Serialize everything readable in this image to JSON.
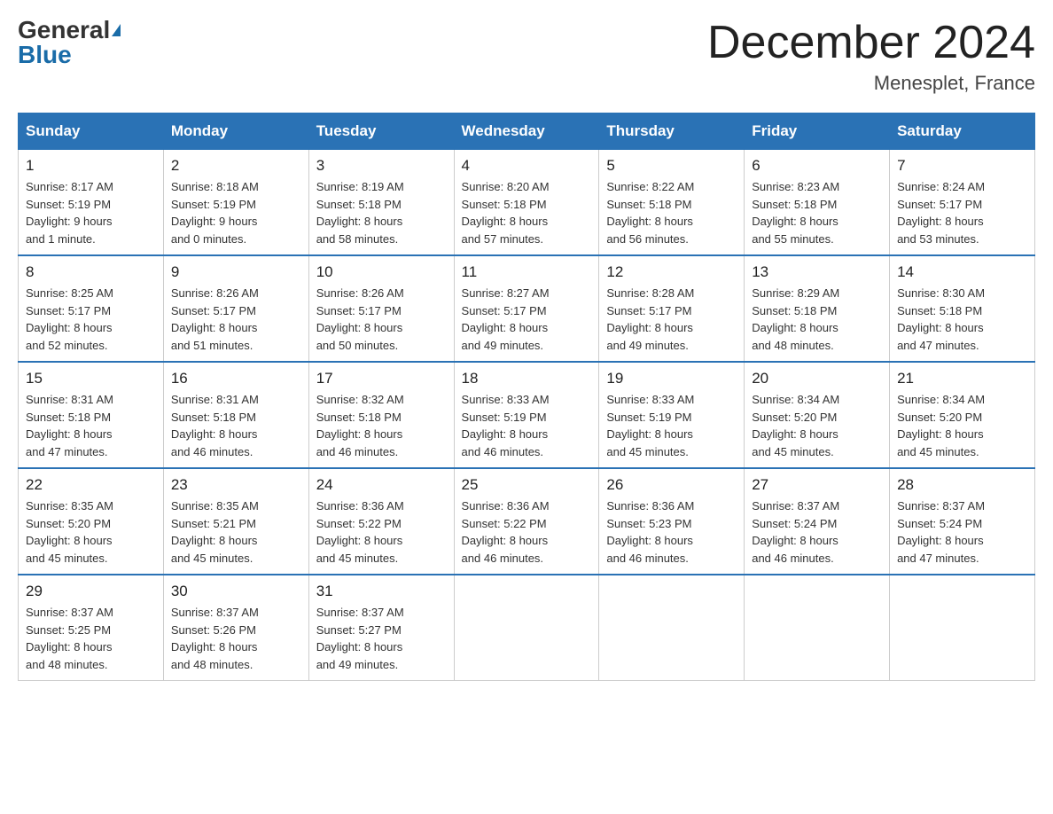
{
  "header": {
    "logo_general": "General",
    "logo_blue": "Blue",
    "month_title": "December 2024",
    "location": "Menesplet, France"
  },
  "weekdays": [
    "Sunday",
    "Monday",
    "Tuesday",
    "Wednesday",
    "Thursday",
    "Friday",
    "Saturday"
  ],
  "weeks": [
    [
      {
        "day": "1",
        "sunrise": "8:17 AM",
        "sunset": "5:19 PM",
        "daylight": "9 hours and 1 minute."
      },
      {
        "day": "2",
        "sunrise": "8:18 AM",
        "sunset": "5:19 PM",
        "daylight": "9 hours and 0 minutes."
      },
      {
        "day": "3",
        "sunrise": "8:19 AM",
        "sunset": "5:18 PM",
        "daylight": "8 hours and 58 minutes."
      },
      {
        "day": "4",
        "sunrise": "8:20 AM",
        "sunset": "5:18 PM",
        "daylight": "8 hours and 57 minutes."
      },
      {
        "day": "5",
        "sunrise": "8:22 AM",
        "sunset": "5:18 PM",
        "daylight": "8 hours and 56 minutes."
      },
      {
        "day": "6",
        "sunrise": "8:23 AM",
        "sunset": "5:18 PM",
        "daylight": "8 hours and 55 minutes."
      },
      {
        "day": "7",
        "sunrise": "8:24 AM",
        "sunset": "5:17 PM",
        "daylight": "8 hours and 53 minutes."
      }
    ],
    [
      {
        "day": "8",
        "sunrise": "8:25 AM",
        "sunset": "5:17 PM",
        "daylight": "8 hours and 52 minutes."
      },
      {
        "day": "9",
        "sunrise": "8:26 AM",
        "sunset": "5:17 PM",
        "daylight": "8 hours and 51 minutes."
      },
      {
        "day": "10",
        "sunrise": "8:26 AM",
        "sunset": "5:17 PM",
        "daylight": "8 hours and 50 minutes."
      },
      {
        "day": "11",
        "sunrise": "8:27 AM",
        "sunset": "5:17 PM",
        "daylight": "8 hours and 49 minutes."
      },
      {
        "day": "12",
        "sunrise": "8:28 AM",
        "sunset": "5:17 PM",
        "daylight": "8 hours and 49 minutes."
      },
      {
        "day": "13",
        "sunrise": "8:29 AM",
        "sunset": "5:18 PM",
        "daylight": "8 hours and 48 minutes."
      },
      {
        "day": "14",
        "sunrise": "8:30 AM",
        "sunset": "5:18 PM",
        "daylight": "8 hours and 47 minutes."
      }
    ],
    [
      {
        "day": "15",
        "sunrise": "8:31 AM",
        "sunset": "5:18 PM",
        "daylight": "8 hours and 47 minutes."
      },
      {
        "day": "16",
        "sunrise": "8:31 AM",
        "sunset": "5:18 PM",
        "daylight": "8 hours and 46 minutes."
      },
      {
        "day": "17",
        "sunrise": "8:32 AM",
        "sunset": "5:18 PM",
        "daylight": "8 hours and 46 minutes."
      },
      {
        "day": "18",
        "sunrise": "8:33 AM",
        "sunset": "5:19 PM",
        "daylight": "8 hours and 46 minutes."
      },
      {
        "day": "19",
        "sunrise": "8:33 AM",
        "sunset": "5:19 PM",
        "daylight": "8 hours and 45 minutes."
      },
      {
        "day": "20",
        "sunrise": "8:34 AM",
        "sunset": "5:20 PM",
        "daylight": "8 hours and 45 minutes."
      },
      {
        "day": "21",
        "sunrise": "8:34 AM",
        "sunset": "5:20 PM",
        "daylight": "8 hours and 45 minutes."
      }
    ],
    [
      {
        "day": "22",
        "sunrise": "8:35 AM",
        "sunset": "5:20 PM",
        "daylight": "8 hours and 45 minutes."
      },
      {
        "day": "23",
        "sunrise": "8:35 AM",
        "sunset": "5:21 PM",
        "daylight": "8 hours and 45 minutes."
      },
      {
        "day": "24",
        "sunrise": "8:36 AM",
        "sunset": "5:22 PM",
        "daylight": "8 hours and 45 minutes."
      },
      {
        "day": "25",
        "sunrise": "8:36 AM",
        "sunset": "5:22 PM",
        "daylight": "8 hours and 46 minutes."
      },
      {
        "day": "26",
        "sunrise": "8:36 AM",
        "sunset": "5:23 PM",
        "daylight": "8 hours and 46 minutes."
      },
      {
        "day": "27",
        "sunrise": "8:37 AM",
        "sunset": "5:24 PM",
        "daylight": "8 hours and 46 minutes."
      },
      {
        "day": "28",
        "sunrise": "8:37 AM",
        "sunset": "5:24 PM",
        "daylight": "8 hours and 47 minutes."
      }
    ],
    [
      {
        "day": "29",
        "sunrise": "8:37 AM",
        "sunset": "5:25 PM",
        "daylight": "8 hours and 48 minutes."
      },
      {
        "day": "30",
        "sunrise": "8:37 AM",
        "sunset": "5:26 PM",
        "daylight": "8 hours and 48 minutes."
      },
      {
        "day": "31",
        "sunrise": "8:37 AM",
        "sunset": "5:27 PM",
        "daylight": "8 hours and 49 minutes."
      },
      null,
      null,
      null,
      null
    ]
  ]
}
